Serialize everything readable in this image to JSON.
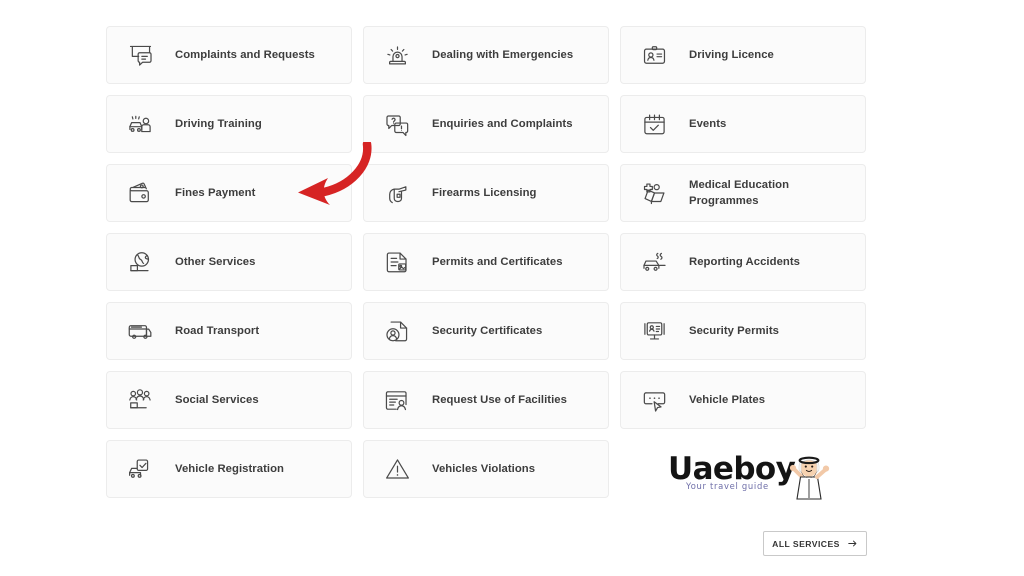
{
  "page": {
    "background_color": "#ffffff",
    "card_background": "#fbfbfb",
    "card_border_color": "#ececec",
    "label_color": "#3d3d3d",
    "icon_color": "#4a4a4a",
    "annotation_color": "#d62424"
  },
  "services": [
    {
      "label": "Complaints and Requests",
      "icon": "presentation-board-chat-icon",
      "column": 1,
      "row": 1
    },
    {
      "label": "Dealing with Emergencies",
      "icon": "emergency-siren-light-icon",
      "column": 2,
      "row": 1
    },
    {
      "label": "Driving Licence",
      "icon": "id-card-person-icon",
      "column": 3,
      "row": 1
    },
    {
      "label": "Driving Training",
      "icon": "car-with-instructor-icon",
      "column": 1,
      "row": 2
    },
    {
      "label": "Enquiries and Complaints",
      "icon": "question-chat-bubbles-icon",
      "column": 2,
      "row": 2
    },
    {
      "label": "Events",
      "icon": "calendar-check-icon",
      "column": 3,
      "row": 2
    },
    {
      "label": "Fines Payment",
      "icon": "wallet-icon",
      "column": 1,
      "row": 3
    },
    {
      "label": "Firearms Licensing",
      "icon": "firearm-icon",
      "column": 2,
      "row": 3
    },
    {
      "label": "Medical Education Programmes",
      "icon": "medical-cross-book-icon",
      "column": 3,
      "row": 3
    },
    {
      "label": "Other Services",
      "icon": "globe-hand-icon",
      "column": 1,
      "row": 4
    },
    {
      "label": "Permits and Certificates",
      "icon": "document-image-icon",
      "column": 2,
      "row": 4
    },
    {
      "label": "Reporting Accidents",
      "icon": "damaged-car-smoke-icon",
      "column": 3,
      "row": 4
    },
    {
      "label": "Road Transport",
      "icon": "bus-icon",
      "column": 1,
      "row": 5
    },
    {
      "label": "Security Certificates",
      "icon": "document-person-badge-icon",
      "column": 2,
      "row": 5
    },
    {
      "label": "Security Permits",
      "icon": "monitor-id-icon",
      "column": 3,
      "row": 5
    },
    {
      "label": "Social Services",
      "icon": "group-people-hand-icon",
      "column": 1,
      "row": 6
    },
    {
      "label": "Request Use of Facilities",
      "icon": "form-person-icon",
      "column": 2,
      "row": 6
    },
    {
      "label": "Vehicle Plates",
      "icon": "plate-cursor-icon",
      "column": 3,
      "row": 6
    },
    {
      "label": "Vehicle Registration",
      "icon": "car-check-icon",
      "column": 1,
      "row": 7
    },
    {
      "label": "Vehicles Violations",
      "icon": "warning-triangle-icon",
      "column": 2,
      "row": 7
    }
  ],
  "annotation": {
    "type": "curved-arrow",
    "points_to": "Fines Payment",
    "color": "#d62424"
  },
  "logo": {
    "word": "Uaeboy",
    "tagline": "Your travel guide",
    "word_color": "#141414",
    "tagline_color": "#6e6ea8",
    "mascot": "emirati-man-waving-icon"
  },
  "all_services_button": {
    "label": "ALL SERVICES",
    "arrow_icon": "arrow-right-icon"
  }
}
